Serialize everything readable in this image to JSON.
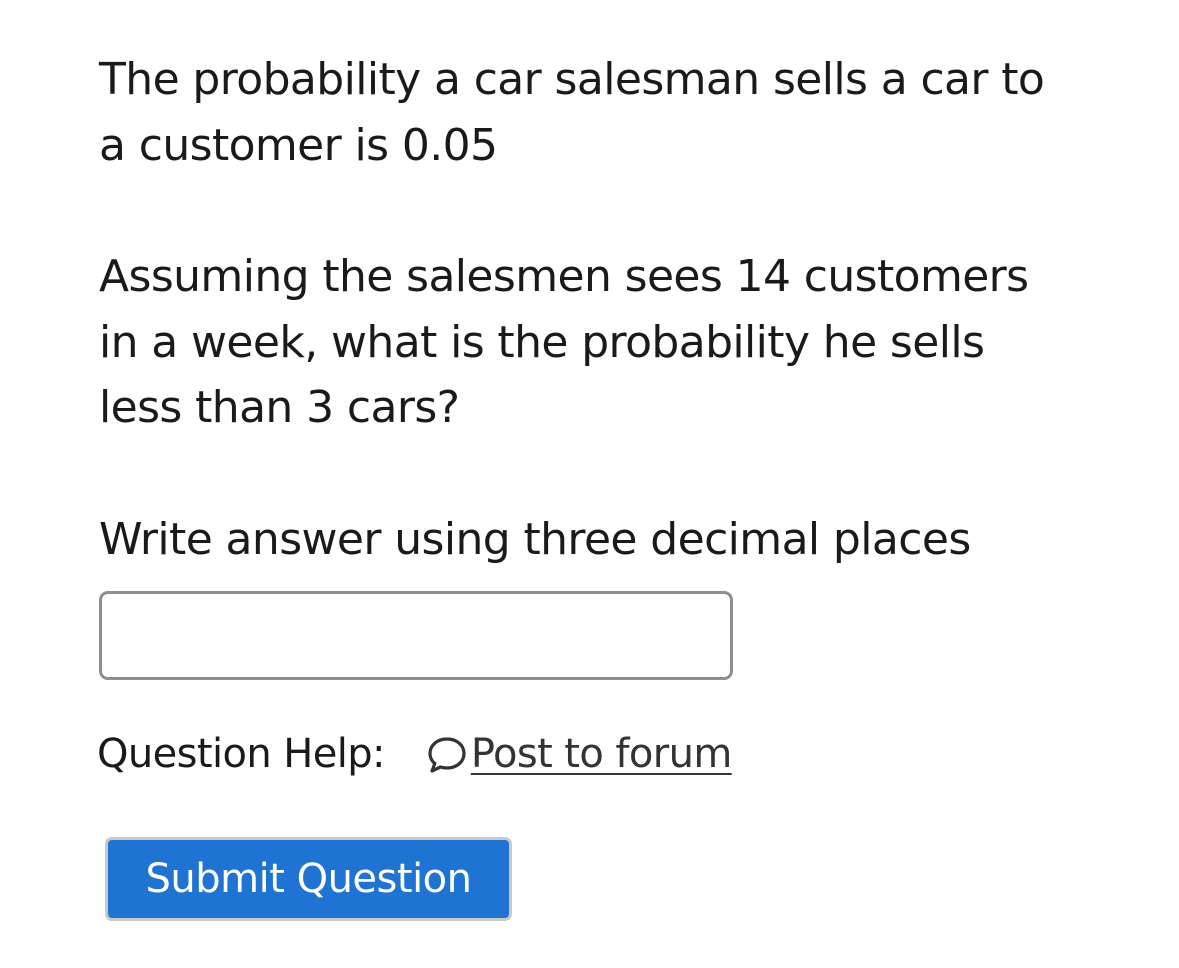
{
  "question": {
    "paragraph1": "The probability a car salesman sells a car to\na customer is 0.05",
    "paragraph2": "Assuming the salesmen sees 14 customers\nin a week, what is the probability he sells\nless than 3 cars?",
    "paragraph3": "Write answer using three decimal places"
  },
  "answer": {
    "value": "",
    "placeholder": ""
  },
  "help": {
    "label": "Question Help:",
    "forum_link": "Post to forum",
    "forum_icon": "speech-bubble-icon"
  },
  "submit": {
    "label": "Submit Question",
    "color": "#1f74d3"
  }
}
